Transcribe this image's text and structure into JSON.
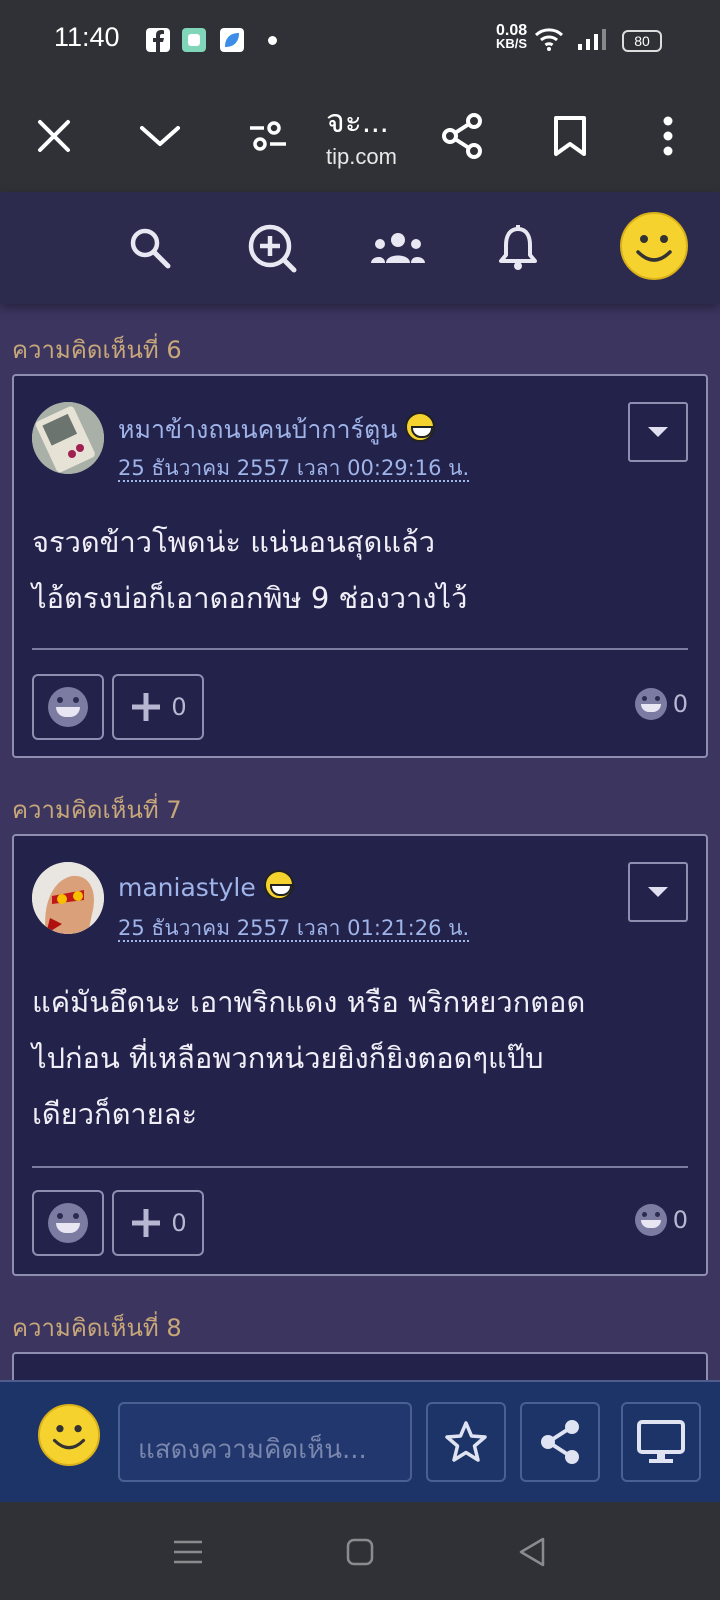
{
  "status_bar": {
    "time": "11:40",
    "speed_value": "0.08",
    "speed_unit": "KB/S",
    "battery": "80"
  },
  "browser": {
    "title": "จะ...",
    "domain": "tip.com"
  },
  "comments": [
    {
      "section_label": "ความคิดเห็นที่ 6",
      "username": "หมาข้างถนนคนบ้าการ์ตูน",
      "date": "25 ธันวาคม 2557 เวลา 00:29:16 น.",
      "lines": [
        "จรวดข้าวโพดน่ะ แน่นอนสุดแล้ว",
        "ไอ้ตรงบ่อก็เอาดอกพิษ 9 ช่องวางไว้"
      ],
      "plus_count": "0",
      "reaction_count": "0"
    },
    {
      "section_label": "ความคิดเห็นที่ 7",
      "username": "maniastyle",
      "date": "25 ธันวาคม 2557 เวลา 01:21:26 น.",
      "lines": [
        "แค่มันอึดนะ เอาพริกแดง หรือ พริกหยวกตอด",
        "ไปก่อน ที่เหลือพวกหน่วยยิงก็ยิงตอดๆแป๊บ",
        "เดียวก็ตายละ"
      ],
      "plus_count": "0",
      "reaction_count": "0"
    },
    {
      "section_label": "ความคิดเห็นที่ 8"
    }
  ],
  "comment_bar": {
    "placeholder": "แสดงความคิดเห็น..."
  },
  "icons": {
    "close": "close-icon",
    "collapse": "chevron-down-icon",
    "customize": "tune-icon",
    "share": "share-icon",
    "bookmark": "bookmark-icon",
    "more": "more-vert-icon",
    "search": "search-icon",
    "new_topic": "add-search-icon",
    "community": "group-icon",
    "notifications": "bell-icon",
    "avatar": "smiley-icon",
    "favorite": "star-icon",
    "desktop": "monitor-icon"
  },
  "colors": {
    "page_bg": "#3c3560",
    "card_bg": "#23224a",
    "section_label": "#c8a878",
    "link": "#9fb4e8",
    "comment_bar": "#1d3468"
  }
}
